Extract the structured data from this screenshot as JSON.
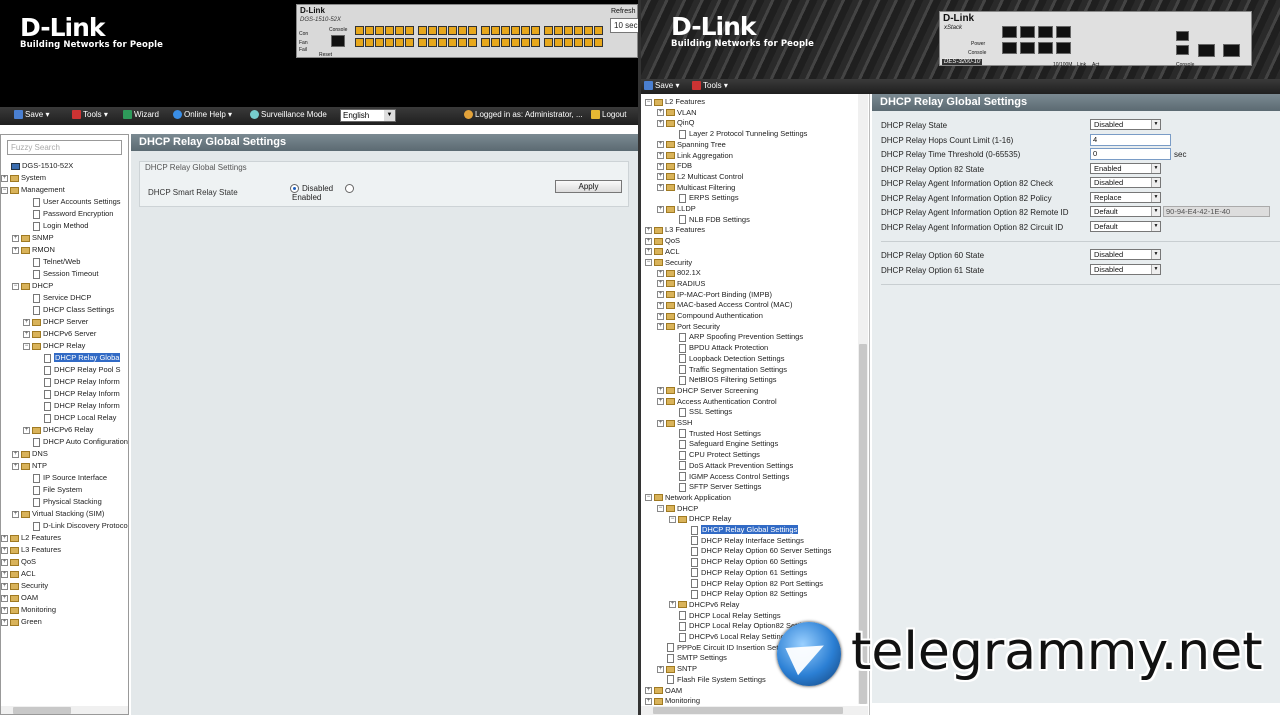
{
  "left": {
    "logo": {
      "name": "D-Link",
      "tagline": "Building Networks for People"
    },
    "device": {
      "brand": "D-Link",
      "model": "DGS-1510-52X",
      "labels": [
        "Con",
        "Fan",
        "Fail",
        "Reset",
        "Console"
      ],
      "refresh_label": "Refresh",
      "refresh_value": "10 sec"
    },
    "toolbar": {
      "save": "Save",
      "tools": "Tools",
      "wizard": "Wizard",
      "online_help": "Online Help",
      "surveillance": "Surveillance Mode",
      "language": "English",
      "logged_in": "Logged in as: Administrator, ...",
      "logout": "Logout"
    },
    "search_placeholder": "Fuzzy Search",
    "tree": [
      "DGS-1510-52X",
      "System",
      "Management",
      "User Accounts Settings",
      "Password Encryption",
      "Login Method",
      "SNMP",
      "RMON",
      "Telnet/Web",
      "Session Timeout",
      "DHCP",
      "Service DHCP",
      "DHCP Class Settings",
      "DHCP Server",
      "DHCPv6 Server",
      "DHCP Relay",
      "DHCP Relay Globa",
      "DHCP Relay Pool S",
      "DHCP Relay Inform",
      "DHCP Relay Inform",
      "DHCP Relay Inform",
      "DHCP Local Relay",
      "DHCPv6 Relay",
      "DHCP Auto Configuration",
      "DNS",
      "NTP",
      "IP Source Interface",
      "File System",
      "Physical Stacking",
      "Virtual Stacking (SIM)",
      "D-Link Discovery Protocol",
      "L2 Features",
      "L3 Features",
      "QoS",
      "ACL",
      "Security",
      "OAM",
      "Monitoring",
      "Green"
    ],
    "content": {
      "title": "DHCP Relay Global Settings",
      "legend": "DHCP Relay Global Settings",
      "smart_relay_label": "DHCP Smart Relay State",
      "option_disabled": "Disabled",
      "option_enabled": "Enabled",
      "apply": "Apply"
    }
  },
  "right": {
    "logo": {
      "name": "D-Link",
      "tagline": "Building Networks for People"
    },
    "device": {
      "brand": "D-Link",
      "sub": "xStack",
      "model": "DES-3200-10",
      "labels": [
        "Power",
        "Console",
        "Console",
        "10/100M",
        "Link",
        "Act"
      ]
    },
    "toolbar": {
      "save": "Save",
      "tools": "Tools"
    },
    "tree": [
      "L2 Features",
      "VLAN",
      "QinQ",
      "Layer 2 Protocol Tunneling Settings",
      "Spanning Tree",
      "Link Aggregation",
      "FDB",
      "L2 Multicast Control",
      "Multicast Filtering",
      "ERPS Settings",
      "LLDP",
      "NLB FDB Settings",
      "L3 Features",
      "QoS",
      "ACL",
      "Security",
      "802.1X",
      "RADIUS",
      "IP-MAC-Port Binding (IMPB)",
      "MAC-based Access Control (MAC)",
      "Compound Authentication",
      "Port Security",
      "ARP Spoofing Prevention Settings",
      "BPDU Attack Protection",
      "Loopback Detection Settings",
      "Traffic Segmentation Settings",
      "NetBIOS Filtering Settings",
      "DHCP Server Screening",
      "Access Authentication Control",
      "SSL Settings",
      "SSH",
      "Trusted Host Settings",
      "Safeguard Engine Settings",
      "CPU Protect Settings",
      "DoS Attack Prevention Settings",
      "IGMP Access Control Settings",
      "SFTP Server Settings",
      "Network Application",
      "DHCP",
      "DHCP Relay",
      "DHCP Relay Global Settings",
      "DHCP Relay Interface Settings",
      "DHCP Relay Option 60 Server Settings",
      "DHCP Relay Option 60 Settings",
      "DHCP Relay Option 61 Settings",
      "DHCP Relay Option 82 Port Settings",
      "DHCP Relay Option 82 Settings",
      "DHCPv6 Relay",
      "DHCP Local Relay Settings",
      "DHCP Local Relay Option82 Settings",
      "DHCPv6 Local Relay Settings",
      "PPPoE Circuit ID Insertion Settings",
      "SMTP Settings",
      "SNTP",
      "Flash File System Settings",
      "OAM",
      "Monitoring"
    ],
    "content": {
      "title": "DHCP Relay Global Settings",
      "rows": [
        {
          "label": "DHCP Relay State",
          "value": "Disabled"
        },
        {
          "label": "DHCP Relay Hops Count Limit (1-16)",
          "value": "4"
        },
        {
          "label": "DHCP Relay Time Threshold (0-65535)",
          "value": "0",
          "unit": "sec"
        },
        {
          "label": "DHCP Relay Option 82 State",
          "value": "Enabled"
        },
        {
          "label": "DHCP Relay Agent Information Option 82 Check",
          "value": "Disabled"
        },
        {
          "label": "DHCP Relay Agent Information Option 82 Policy",
          "value": "Replace"
        },
        {
          "label": "DHCP Relay Agent Information Option 82 Remote ID",
          "value": "Default",
          "extra": "90-94-E4-42-1E-40"
        },
        {
          "label": "DHCP Relay Agent Information Option 82 Circuit ID",
          "value": "Default"
        }
      ],
      "rows2": [
        {
          "label": "DHCP Relay Option 60 State",
          "value": "Disabled"
        },
        {
          "label": "DHCP Relay Option 61 State",
          "value": "Disabled"
        }
      ]
    }
  },
  "watermark": {
    "text": "telegrammy.net"
  },
  "colors": {
    "banner": "#000000",
    "toolbar": "#2b2b2b",
    "content_bg": "#e3e8ea",
    "title_bar": "#6b7a82",
    "selection": "#316ac5",
    "port_orange": "#e8a81c"
  }
}
